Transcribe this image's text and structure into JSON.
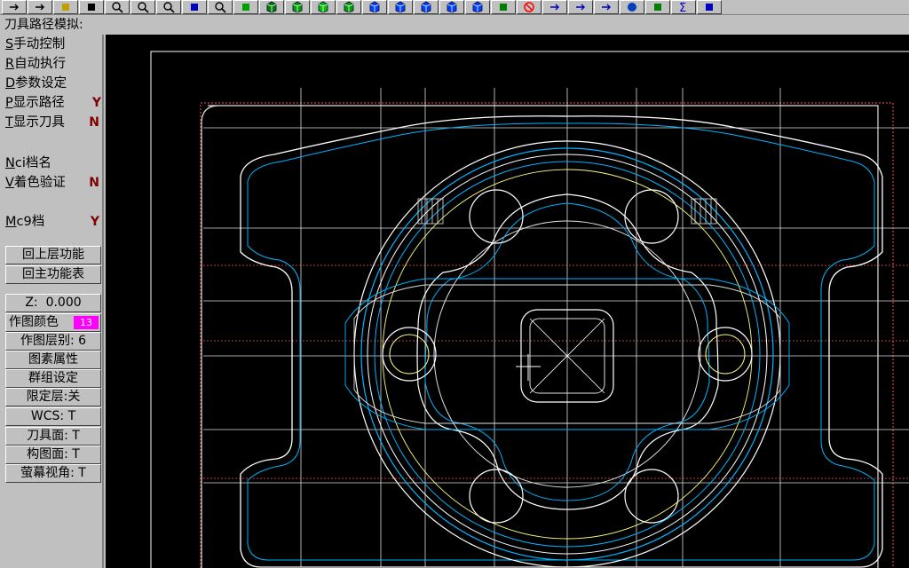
{
  "app": {
    "prompt": "刀具路径模拟:"
  },
  "toolbar": {
    "buttons": [
      {
        "icon": "arrow-left-icon"
      },
      {
        "icon": "arrow-right-icon"
      },
      {
        "icon": "clipboard-icon"
      },
      {
        "icon": "pointer-icon"
      },
      {
        "icon": "zoom-window-icon"
      },
      {
        "icon": "zoom-in-icon"
      },
      {
        "icon": "zoom-out-icon"
      },
      {
        "icon": "move-down-icon"
      },
      {
        "icon": "zoom-extents-icon"
      },
      {
        "icon": "view-cycle-icon"
      },
      {
        "icon": "cube-top-icon"
      },
      {
        "icon": "cube-front-icon"
      },
      {
        "icon": "cube-side-icon"
      },
      {
        "icon": "cube-iso-icon"
      },
      {
        "icon": "cube-blue-icon"
      },
      {
        "icon": "cube-blue2-icon"
      },
      {
        "icon": "cube-blue3-icon"
      },
      {
        "icon": "cube-blue4-icon"
      },
      {
        "icon": "cube-blue5-icon"
      },
      {
        "icon": "pen-icon"
      },
      {
        "icon": "no-entry-icon"
      },
      {
        "icon": "arrow-blue-icon"
      },
      {
        "icon": "arrow-blue2-icon"
      },
      {
        "icon": "arrow-blue3-icon"
      },
      {
        "icon": "sphere-icon"
      },
      {
        "icon": "trash-icon"
      },
      {
        "icon": "sigma-icon"
      },
      {
        "icon": "next-arrow-icon"
      }
    ]
  },
  "menu": {
    "items": [
      {
        "hotkey": "S",
        "label": "手动控制",
        "flag": ""
      },
      {
        "hotkey": "R",
        "label": "自动执行",
        "flag": ""
      },
      {
        "hotkey": "D",
        "label": "参数设定",
        "flag": ""
      },
      {
        "hotkey": "P",
        "label": "显示路径",
        "flag": "Y"
      },
      {
        "hotkey": "T",
        "label": "显示刀具",
        "flag": "N"
      },
      {
        "hotkey": "N",
        "label": "ci档名",
        "flag": ""
      },
      {
        "hotkey": "V",
        "label": "着色验证",
        "flag": "N"
      },
      {
        "hotkey": "M",
        "label": "c9档",
        "flag": "Y"
      }
    ],
    "nav_buttons": [
      "回上层功能",
      "回主功能表"
    ]
  },
  "status": {
    "z_label": "Z:",
    "z_value": "0.000",
    "color_label": "作图颜色",
    "color_value": "13",
    "color_hex": "#ff00ff",
    "level_label": "作图层别:",
    "level_value": "6",
    "entity_attr": "图素属性",
    "group_set": "群组设定",
    "mask_label": "限定层:",
    "mask_value": "关",
    "wcs_label": "WCS:",
    "wcs_value": "T",
    "tplane_label": "刀具面:",
    "tplane_value": "T",
    "cplane_label": "构图面:",
    "cplane_value": "T",
    "gview_label": "萤幕视角:",
    "gview_value": "T"
  },
  "colors": {
    "background": "#000000",
    "geometry": "#ffffff",
    "toolpath": "#00b4ff",
    "aux": "#ffff80",
    "border": "#ff5050"
  }
}
